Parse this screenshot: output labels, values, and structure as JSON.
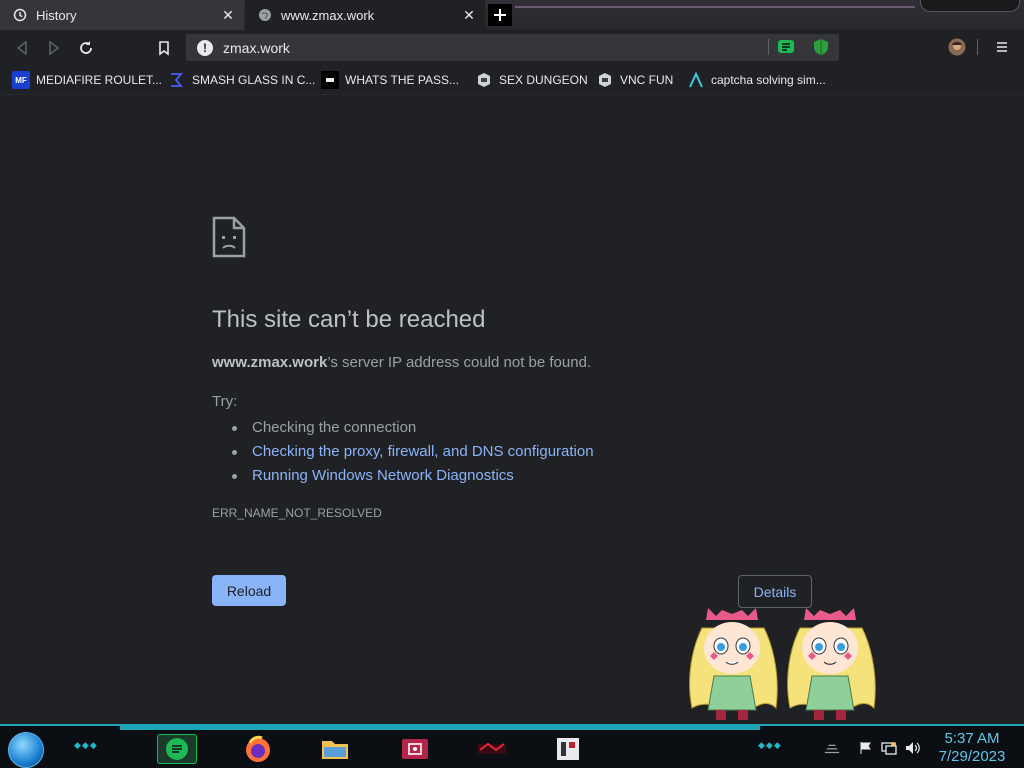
{
  "tabs": [
    {
      "title": "History",
      "icon": "history-icon"
    },
    {
      "title": "www.zmax.work",
      "icon": "globe-icon"
    }
  ],
  "omnibox": {
    "url": "zmax.work"
  },
  "bookmarks": [
    {
      "label": "MEDIAFIRE ROULET...",
      "icon": "mediafire-icon"
    },
    {
      "label": "SMASH GLASS IN C...",
      "icon": "smash-icon"
    },
    {
      "label": "WHATS THE PASS...",
      "icon": "pass-icon"
    },
    {
      "label": "SEX DUNGEON",
      "icon": "dungeon-icon"
    },
    {
      "label": "VNC FUN",
      "icon": "vnc-icon"
    },
    {
      "label": "captcha solving sim...",
      "icon": "captcha-icon"
    }
  ],
  "error": {
    "title": "This site can’t be reached",
    "host": "www.zmax.work",
    "message_tail": "’s server IP address could not be found.",
    "try_label": "Try:",
    "suggestions": [
      "Checking the connection",
      "Checking the proxy, firewall, and DNS configuration",
      "Running Windows Network Diagnostics"
    ],
    "code": "ERR_NAME_NOT_RESOLVED",
    "reload_label": "Reload",
    "details_label": "Details"
  },
  "taskbar": {
    "time": "5:37 AM",
    "date": "7/29/2023"
  },
  "colors": {
    "background": "#202124",
    "link": "#8ab4f8",
    "accent": "#1aa6b7"
  }
}
